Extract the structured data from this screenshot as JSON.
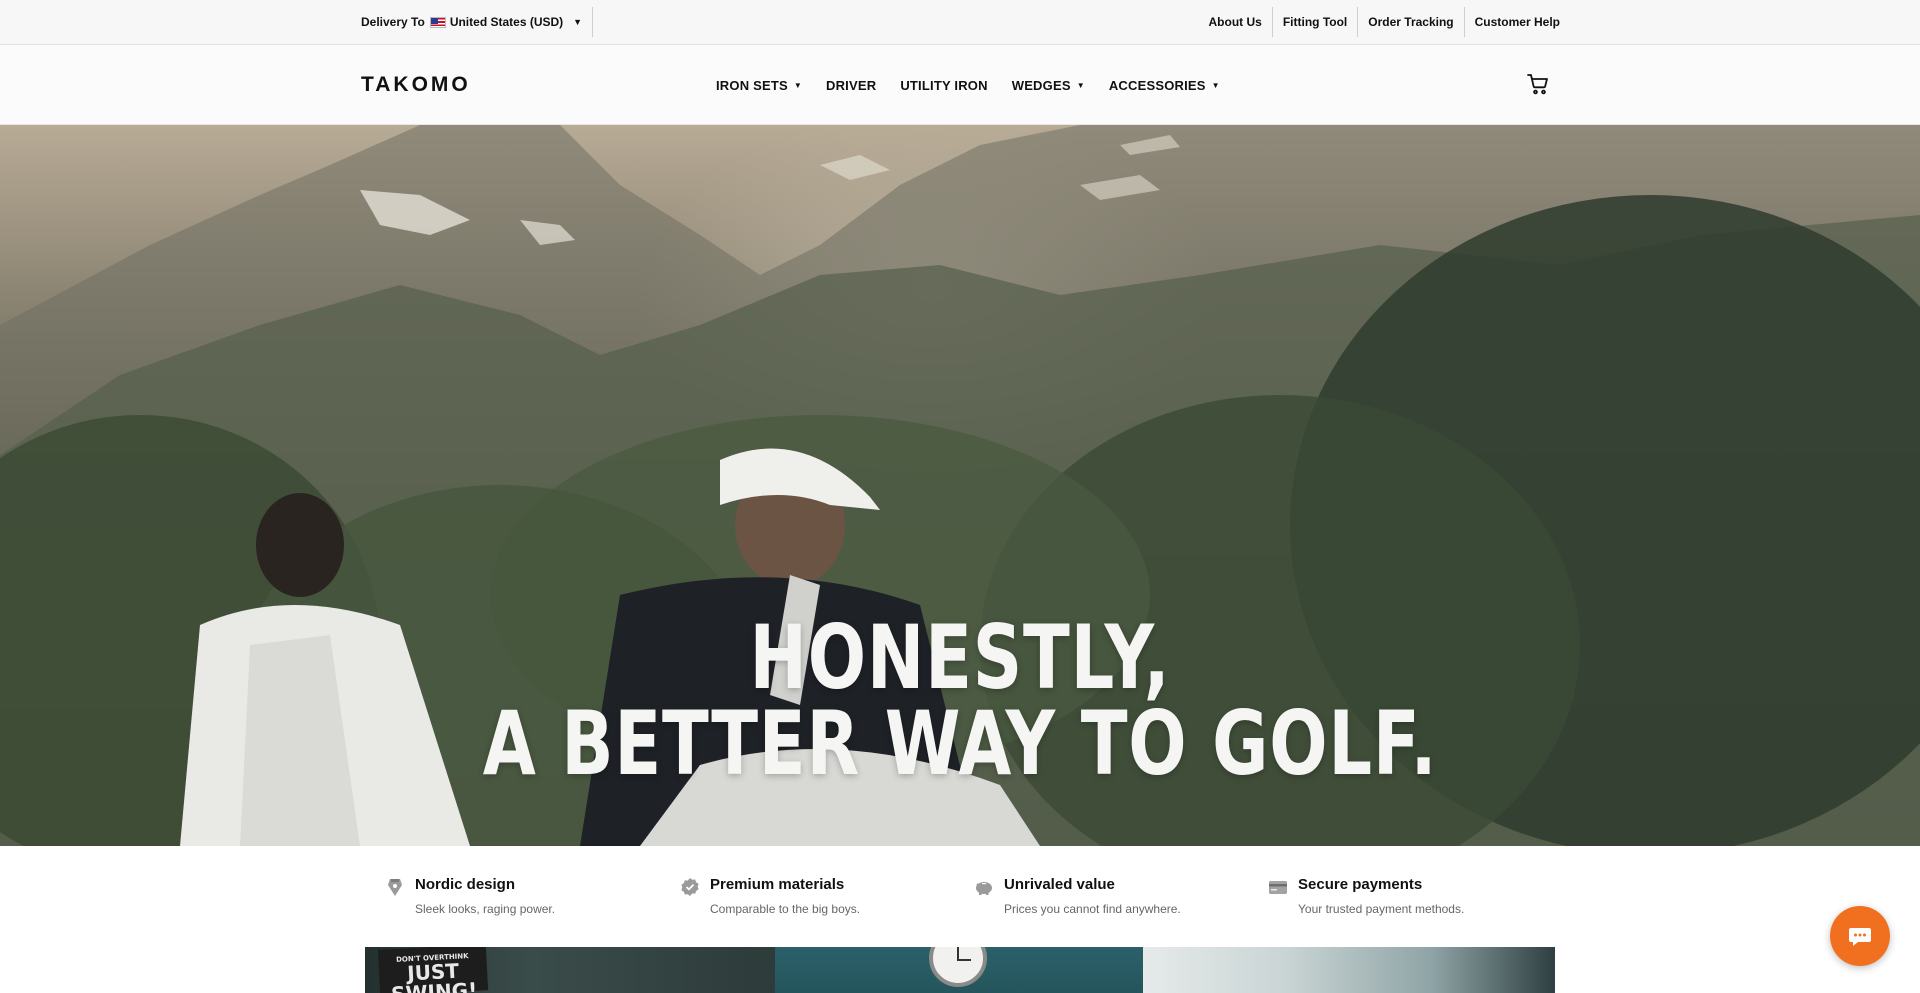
{
  "topbar": {
    "delivery_label": "Delivery To",
    "country": "United States (USD)",
    "flag_icon": "us-flag-icon",
    "links": [
      "About Us",
      "Fitting Tool",
      "Order Tracking",
      "Customer Help"
    ]
  },
  "header": {
    "logo": "TAKOMO",
    "nav": [
      {
        "label": "IRON SETS",
        "dropdown": true
      },
      {
        "label": "DRIVER",
        "dropdown": false
      },
      {
        "label": "UTILITY IRON",
        "dropdown": false
      },
      {
        "label": "WEDGES",
        "dropdown": true
      },
      {
        "label": "ACCESSORIES",
        "dropdown": true
      }
    ],
    "dropdown_glyph": "▼",
    "cart_icon": "cart-icon"
  },
  "hero": {
    "line1": "HONESTLY,",
    "line2": "A BETTER WAY TO GOLF."
  },
  "features": [
    {
      "icon": "pen-nib-icon",
      "title": "Nordic design",
      "desc": "Sleek looks, raging power."
    },
    {
      "icon": "verified-badge-icon",
      "title": "Premium materials",
      "desc": "Comparable to the big boys."
    },
    {
      "icon": "piggy-bank-icon",
      "title": "Unrivaled value",
      "desc": "Prices you cannot find anywhere."
    },
    {
      "icon": "credit-card-icon",
      "title": "Secure payments",
      "desc": "Your trusted payment methods."
    }
  ],
  "strip": {
    "poster_small": "DON'T OVERTHINK",
    "poster_big": "JUST SWING!"
  },
  "chat": {
    "icon": "chat-bubble-icon"
  },
  "colors": {
    "accent": "#f0701f",
    "text": "#111111",
    "muted": "#666666",
    "topbar_bg": "#f7f7f7"
  }
}
